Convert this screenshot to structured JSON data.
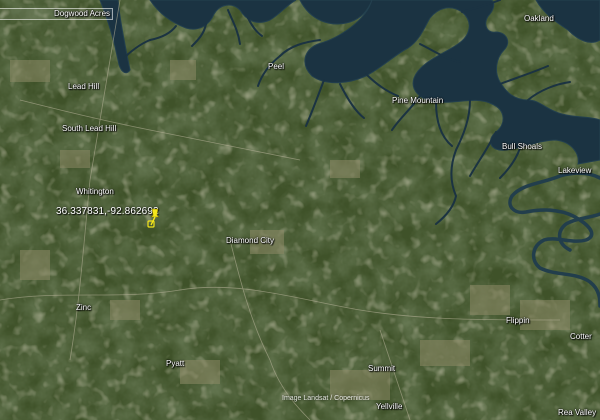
{
  "map": {
    "labels": {
      "dogwood_acres": "Dogwood Acres",
      "oakland": "Oakland",
      "lead_hill": "Lead Hill",
      "peel": "Peel",
      "pine_mountain": "Pine Mountain",
      "south_lead_hill": "South Lead Hill",
      "bull_shoals": "Bull Shoals",
      "lakeview": "Lakeview",
      "whitington": "Whitington",
      "diamond_city": "Diamond City",
      "zinc": "Zinc",
      "flippin": "Flippin",
      "cotter": "Cotter",
      "pyatt": "Pyatt",
      "summit": "Summit",
      "yellville": "Yellville",
      "rea_valley": "Rea Valley"
    },
    "marker": {
      "coordinates_label": "36.337831,-92.862692",
      "latitude": 36.337831,
      "longitude": -92.862692,
      "color": "#f5e61a"
    },
    "attribution": "Image Landsat / Copernicus",
    "colors": {
      "water": "#1b3342",
      "vegetation": "#3d5029",
      "fields": "#8a8a6a"
    }
  }
}
